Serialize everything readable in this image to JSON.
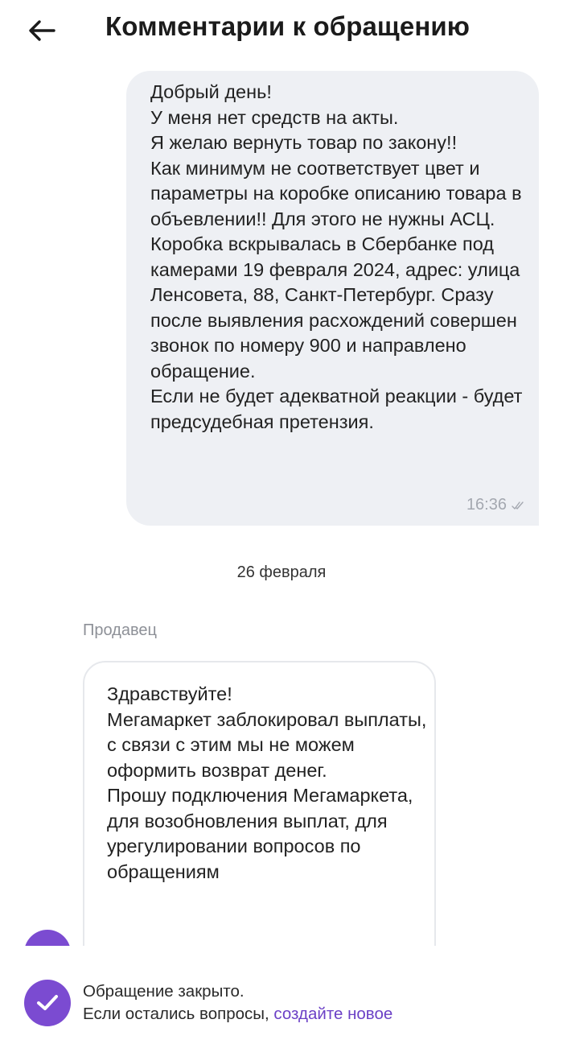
{
  "header": {
    "title": "Комментарии к обращению",
    "back_icon": "arrow-left-icon"
  },
  "messages": {
    "outgoing": {
      "text": "Добрый день!\nУ меня нет средств на акты.\nЯ желаю вернуть товар по закону!!\nКак минимум не соответствует цвет и параметры на коробке описанию товара в объевлении!! Для этого не нужны АСЦ.\nКоробка вскрывалась в Сбербанке под камерами 19 февраля 2024, адрес: улица Ленсовета, 88, Санкт-Петербург. Сразу после выявления расхождений совершен звонок по номеру 900 и направлено обращение.\nЕсли не будет адекватной реакции - будет предсудебная претензия.",
      "time": "16:36",
      "status_icon": "double-check-icon"
    },
    "date_separator": "26 февраля",
    "incoming": {
      "sender": "Продавец",
      "text": "Здравствуйте!\nМегамаркет заблокировал выплаты, с связи с этим мы не можем оформить возврат денег.\nПрошу подключения Мегамаркета, для возобновления выплат, для урегулировании вопросов по обращениям"
    }
  },
  "footer": {
    "status_title": "Обращение закрыто.",
    "status_text": "Если остались вопросы, ",
    "create_link": "создайте новое",
    "icon": "check-circle-icon"
  },
  "colors": {
    "accent": "#7b4bd1",
    "link": "#6b40c6",
    "bubble_out_bg": "#eef0f4",
    "muted_text": "#8d9097"
  }
}
